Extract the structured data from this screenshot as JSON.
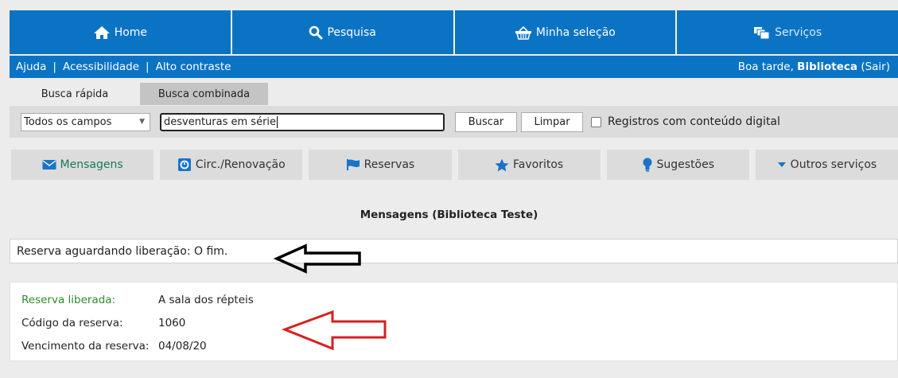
{
  "topnav": {
    "tabs": [
      {
        "label": "Home",
        "icon": "home-icon"
      },
      {
        "label": "Pesquisa",
        "icon": "search-icon"
      },
      {
        "label": "Minha seleção",
        "icon": "basket-icon"
      },
      {
        "label": "Serviços",
        "icon": "services-icon",
        "active": true
      }
    ],
    "color": "#0b73c4"
  },
  "subbar": {
    "links": [
      "Ajuda",
      "Acessibilidade",
      "Alto contraste"
    ],
    "separator": "|",
    "greeting_prefix": "Boa tarde,",
    "user": "Biblioteca",
    "logout": "(Sair)"
  },
  "search": {
    "tabs": [
      "Busca rápida",
      "Busca combinada"
    ],
    "field_select": "Todos os campos",
    "query": "desventuras em série",
    "buscar": "Buscar",
    "limpar": "Limpar",
    "digital_checkbox_label": "Registros com conteúdo digital"
  },
  "services": {
    "items": [
      {
        "label": "Mensagens",
        "icon": "envelope-icon",
        "active": true
      },
      {
        "label": "Circ./Renovação",
        "icon": "circulation-icon"
      },
      {
        "label": "Reservas",
        "icon": "flag-icon"
      },
      {
        "label": "Favoritos",
        "icon": "star-icon"
      },
      {
        "label": "Sugestões",
        "icon": "lightbulb-icon"
      },
      {
        "label": "Outros serviços",
        "icon": "caret-down-icon"
      }
    ]
  },
  "messages": {
    "title": "Mensagens (Biblioteca Teste)",
    "pending": "Reserva aguardando liberação: O fim.",
    "released": {
      "label_released": "Reserva liberada:",
      "value_released": "A sala dos répteis",
      "label_code": "Código da reserva:",
      "value_code": "1060",
      "label_due": "Vencimento da reserva:",
      "value_due": "04/08/20"
    }
  },
  "annotations": {
    "arrow1_color": "#000000",
    "arrow2_color": "#d62020"
  }
}
